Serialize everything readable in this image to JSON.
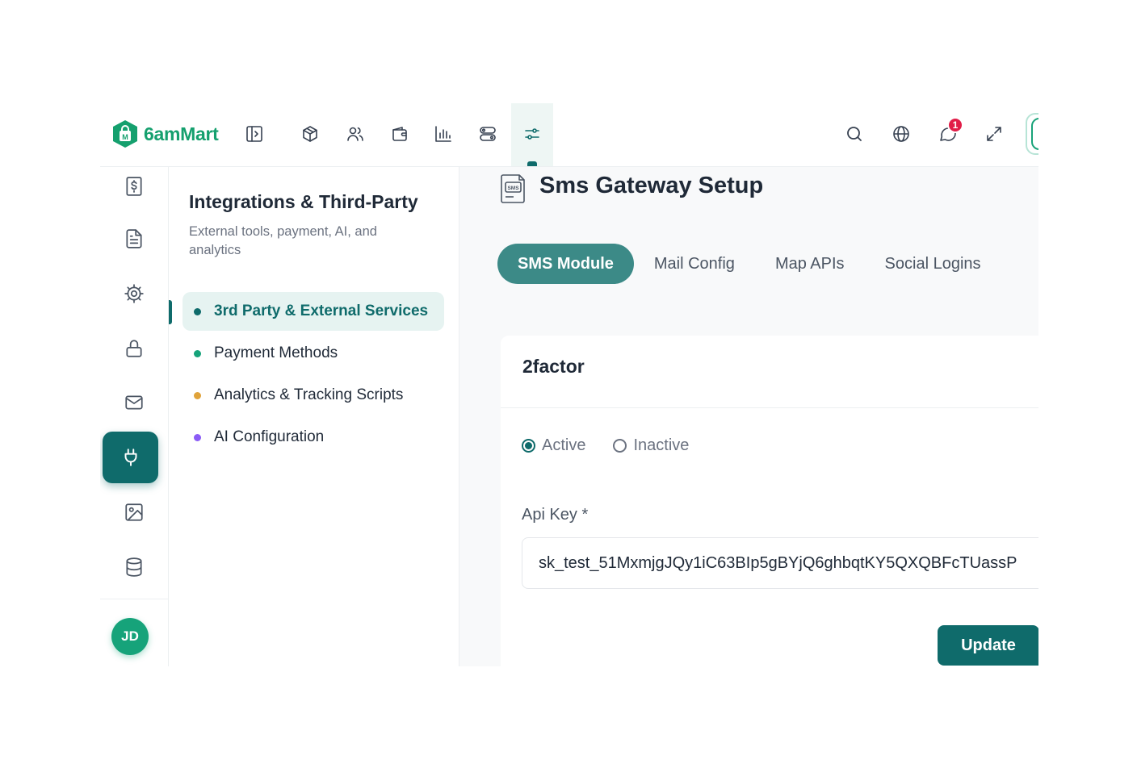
{
  "brand": {
    "name": "6amMart",
    "accent": "#0f6b6b",
    "logo_color": "#15a06e"
  },
  "topbar": {
    "nav_icons": [
      "sidebar-toggle-icon",
      "box-icon",
      "users-icon",
      "wallet-icon",
      "bar-chart-icon",
      "route-icon",
      "sliders-icon"
    ],
    "active_icon": "sliders-icon",
    "right_icons": [
      "search-icon",
      "globe-icon",
      "chat-icon",
      "expand-icon"
    ],
    "notification_count": "1"
  },
  "rail": {
    "items": [
      "dollar-document-icon",
      "document-icon",
      "gear-icon",
      "lock-icon",
      "mail-icon",
      "plug-icon",
      "image-icon",
      "database-icon"
    ],
    "active_item": "plug-icon",
    "avatar_initials": "JD"
  },
  "sidebar": {
    "title": "Integrations & Third-Party",
    "subtitle": "External tools, payment, AI, and analytics",
    "items": [
      {
        "label": "3rd Party & External Services",
        "dot_color": "#0f6b6b",
        "active": true
      },
      {
        "label": "Payment Methods",
        "dot_color": "#16a37a",
        "active": false
      },
      {
        "label": "Analytics & Tracking Scripts",
        "dot_color": "#e0a33a",
        "active": false
      },
      {
        "label": "AI Configuration",
        "dot_color": "#8b5cf6",
        "active": false
      }
    ]
  },
  "main": {
    "page_title": "Sms Gateway Setup",
    "sms_icon": "sms-document-icon",
    "tabs": [
      {
        "label": "SMS Module",
        "active": true
      },
      {
        "label": "Mail Config",
        "active": false
      },
      {
        "label": "Map APIs",
        "active": false
      },
      {
        "label": "Social Logins",
        "active": false
      }
    ],
    "card": {
      "title": "2factor",
      "status_options": [
        {
          "label": "Active",
          "checked": true
        },
        {
          "label": "Inactive",
          "checked": false
        }
      ],
      "api_key_label": "Api Key *",
      "api_key_value": "sk_test_51MxmjgJQy1iC63BIp5gBYjQ6ghbqtKY5QXQBFcTUassP",
      "update_label": "Update"
    }
  }
}
